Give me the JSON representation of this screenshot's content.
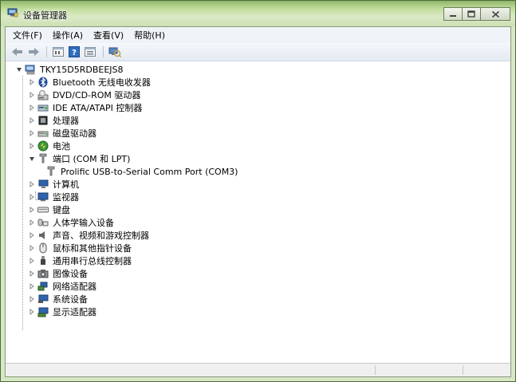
{
  "window": {
    "title": "设备管理器"
  },
  "menu": [
    {
      "label": "文件(F)"
    },
    {
      "label": "操作(A)"
    },
    {
      "label": "查看(V)"
    },
    {
      "label": "帮助(H)"
    }
  ],
  "toolbar": {
    "icons": [
      "back-icon",
      "forward-icon",
      "properties-icon",
      "help-icon",
      "view-icon",
      "scan-hardware-icon"
    ]
  },
  "tree": {
    "root": {
      "label": "TKY15D5RDBEEJS8",
      "icon": "computer-icon",
      "expanded": true
    },
    "items": [
      {
        "label": "Bluetooth 无线电收发器",
        "icon": "bluetooth-icon",
        "expanded": false
      },
      {
        "label": "DVD/CD-ROM 驱动器",
        "icon": "dvd-drive-icon",
        "expanded": false
      },
      {
        "label": "IDE ATA/ATAPI 控制器",
        "icon": "ide-controller-icon",
        "expanded": false
      },
      {
        "label": "处理器",
        "icon": "processor-icon",
        "expanded": false
      },
      {
        "label": "磁盘驱动器",
        "icon": "disk-drive-icon",
        "expanded": false
      },
      {
        "label": "电池",
        "icon": "battery-icon",
        "expanded": false
      },
      {
        "label": "端口 (COM 和 LPT)",
        "icon": "port-icon",
        "expanded": true,
        "children": [
          {
            "label": "Prolific USB-to-Serial Comm Port (COM3)",
            "icon": "port-icon"
          }
        ]
      },
      {
        "label": "计算机",
        "icon": "computer-icon",
        "expanded": false
      },
      {
        "label": "监视器",
        "icon": "monitor-icon",
        "expanded": false
      },
      {
        "label": "键盘",
        "icon": "keyboard-icon",
        "expanded": false
      },
      {
        "label": "人体学输入设备",
        "icon": "hid-icon",
        "expanded": false
      },
      {
        "label": "声音、视频和游戏控制器",
        "icon": "sound-icon",
        "expanded": false
      },
      {
        "label": "鼠标和其他指针设备",
        "icon": "mouse-icon",
        "expanded": false
      },
      {
        "label": "通用串行总线控制器",
        "icon": "usb-icon",
        "expanded": false
      },
      {
        "label": "图像设备",
        "icon": "imaging-icon",
        "expanded": false
      },
      {
        "label": "网络适配器",
        "icon": "network-icon",
        "expanded": false
      },
      {
        "label": "系统设备",
        "icon": "system-device-icon",
        "expanded": false
      },
      {
        "label": "显示适配器",
        "icon": "display-adapter-icon",
        "expanded": false
      }
    ]
  },
  "colors": {
    "titlebar": "#c2dd9b",
    "menubar": "#f0f4f9",
    "tree_bg": "#ffffff"
  }
}
